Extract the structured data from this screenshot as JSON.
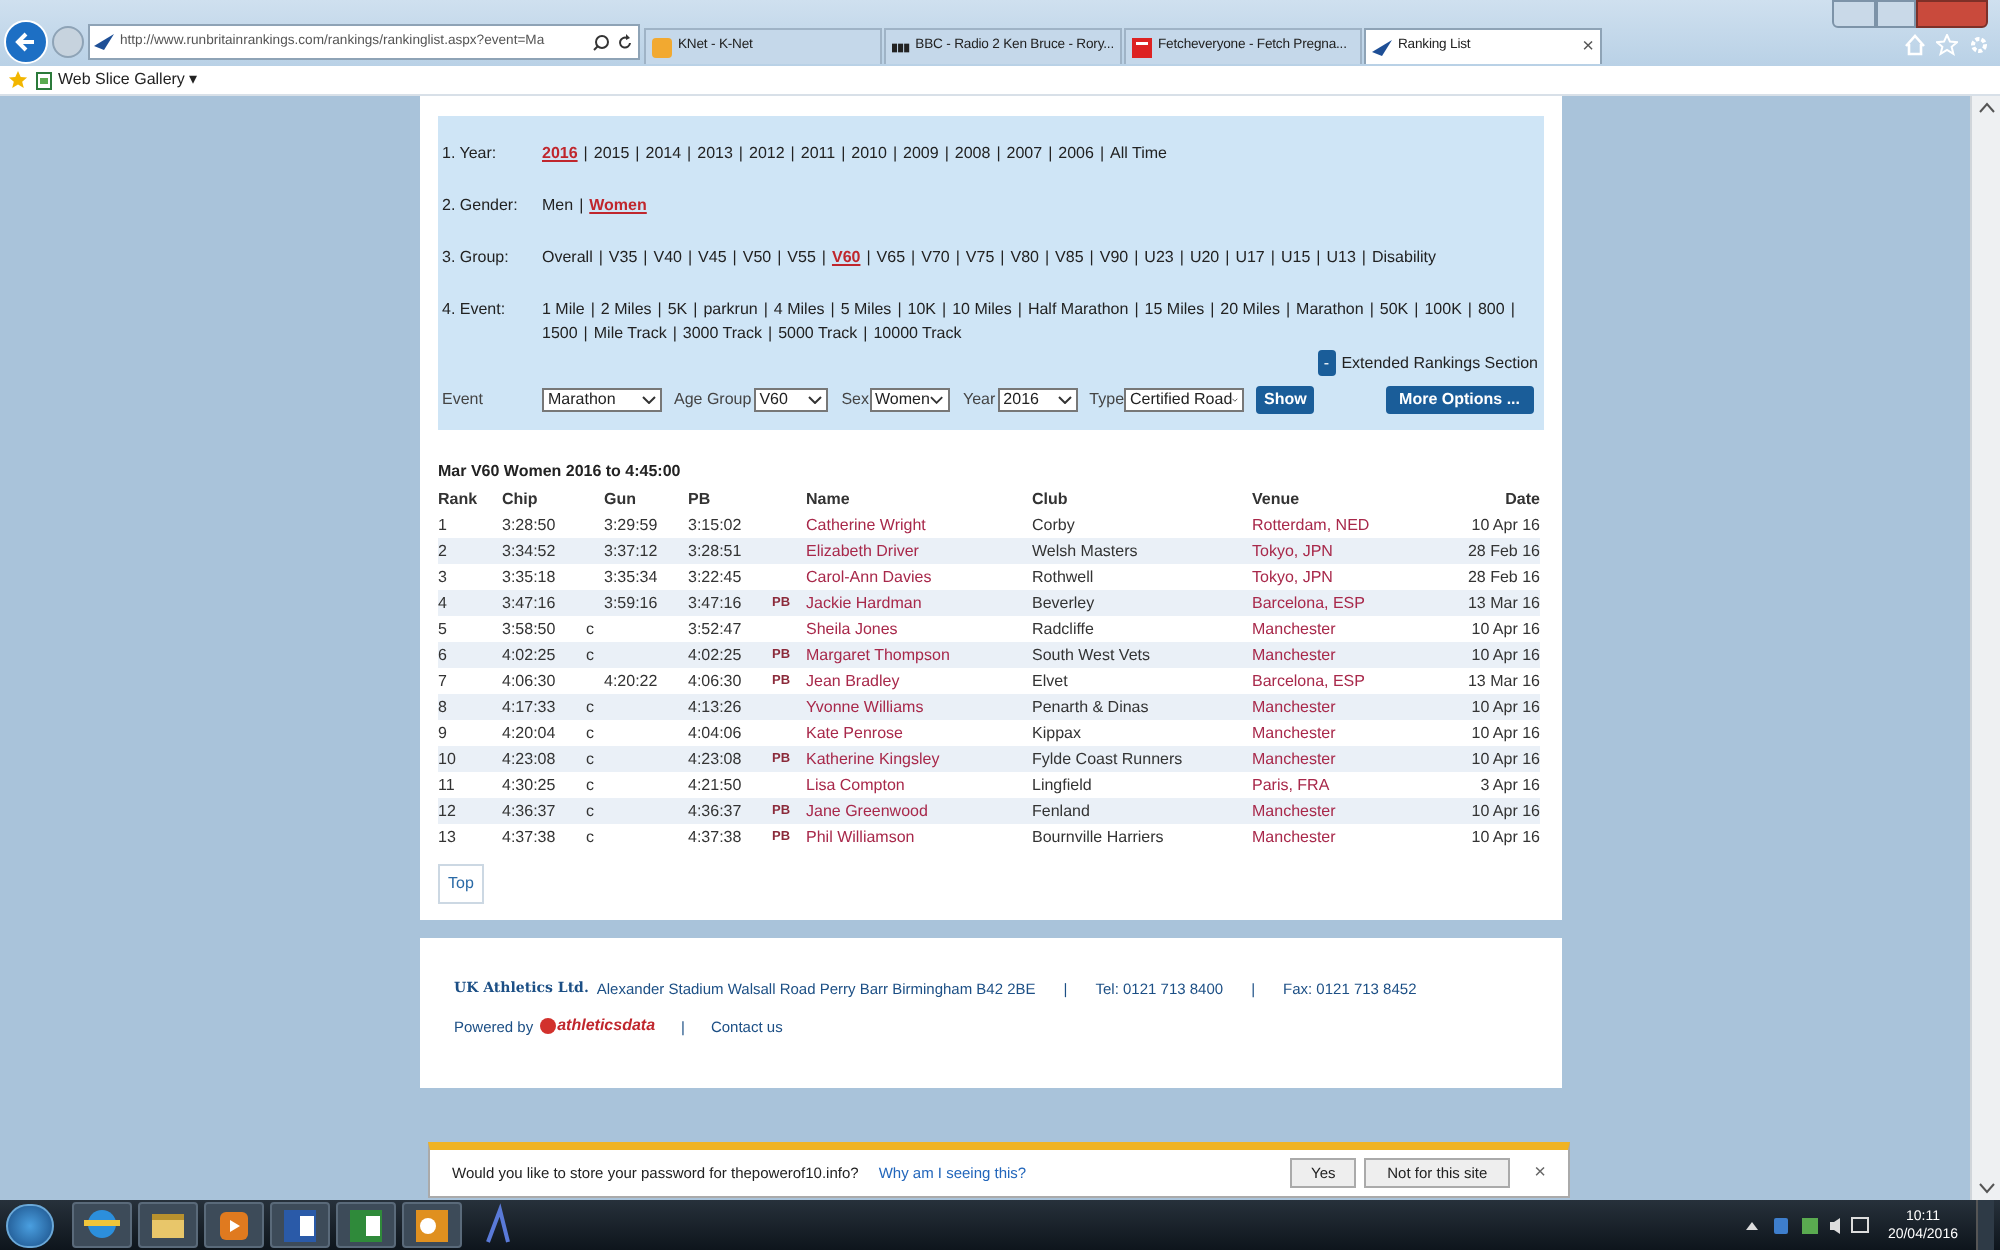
{
  "browser": {
    "address": "http://www.runbritainrankings.com/rankings/rankinglist.aspx?event=Ma",
    "tabs": [
      {
        "label": "KNet  - K-Net",
        "selected": false
      },
      {
        "label": "BBC - Radio 2 Ken Bruce - Rory...",
        "selected": false
      },
      {
        "label": "Fetcheveryone - Fetch Pregna...",
        "selected": false
      },
      {
        "label": "Ranking List",
        "selected": true,
        "close": "×"
      }
    ],
    "favorites": [
      {
        "label": "Web Slice Gallery ▾"
      }
    ]
  },
  "filters": [
    {
      "label": "1. Year:",
      "separator": "|",
      "options": [
        {
          "text": "2016",
          "selected": true
        },
        {
          "text": "2015",
          "selected": false
        },
        {
          "text": "2014",
          "selected": false
        },
        {
          "text": "2013",
          "selected": false
        },
        {
          "text": "2012",
          "selected": false
        },
        {
          "text": "2011",
          "selected": false
        },
        {
          "text": "2010",
          "selected": false
        },
        {
          "text": "2009",
          "selected": false
        },
        {
          "text": "2008",
          "selected": false
        },
        {
          "text": "2007",
          "selected": false
        },
        {
          "text": "2006",
          "selected": false
        },
        {
          "text": "All Time",
          "selected": false
        }
      ]
    },
    {
      "label": "2. Gender:",
      "separator": "|",
      "options": [
        {
          "text": "Men",
          "selected": false
        },
        {
          "text": "Women",
          "selected": true
        }
      ]
    },
    {
      "label": "3. Group:",
      "separator": "|",
      "options": [
        {
          "text": "Overall",
          "selected": false
        },
        {
          "text": "V35",
          "selected": false
        },
        {
          "text": "V40",
          "selected": false
        },
        {
          "text": "V45",
          "selected": false
        },
        {
          "text": "V50",
          "selected": false
        },
        {
          "text": "V55",
          "selected": false
        },
        {
          "text": "V60",
          "selected": true
        },
        {
          "text": "V65",
          "selected": false
        },
        {
          "text": "V70",
          "selected": false
        },
        {
          "text": "V75",
          "selected": false
        },
        {
          "text": "V80",
          "selected": false
        },
        {
          "text": "V85",
          "selected": false
        },
        {
          "text": "V90",
          "selected": false
        },
        {
          "text": "U23",
          "selected": false
        },
        {
          "text": "U20",
          "selected": false
        },
        {
          "text": "U17",
          "selected": false
        },
        {
          "text": "U15",
          "selected": false
        },
        {
          "text": "U13",
          "selected": false
        },
        {
          "text": "Disability",
          "selected": false
        }
      ]
    },
    {
      "label": "4. Event:",
      "separator": "|",
      "options": [
        {
          "text": "1 Mile",
          "selected": false
        },
        {
          "text": "2 Miles",
          "selected": false
        },
        {
          "text": "5K",
          "selected": false
        },
        {
          "text": "parkrun",
          "selected": false
        },
        {
          "text": "4 Miles",
          "selected": false
        },
        {
          "text": "5 Miles",
          "selected": false
        },
        {
          "text": "10K",
          "selected": false
        },
        {
          "text": "10 Miles",
          "selected": false
        },
        {
          "text": "Half Marathon",
          "selected": false
        },
        {
          "text": "15 Miles",
          "selected": false
        },
        {
          "text": "20 Miles",
          "selected": false
        },
        {
          "text": "Marathon",
          "selected": false
        },
        {
          "text": "50K",
          "selected": false
        },
        {
          "text": "100K",
          "selected": false
        },
        {
          "text": "800",
          "selected": false
        },
        {
          "text": "1500",
          "selected": false
        },
        {
          "text": "Mile Track",
          "selected": false
        },
        {
          "text": "3000 Track",
          "selected": false
        },
        {
          "text": "5000 Track",
          "selected": false
        },
        {
          "text": "10000 Track",
          "selected": false
        }
      ]
    }
  ],
  "extended": {
    "toggle": "-",
    "label": "Extended Rankings Section"
  },
  "controls": {
    "event_label": "Event",
    "event": "Marathon",
    "age_label": "Age Group",
    "age": "V60",
    "sex_label": "Sex",
    "sex": "Women",
    "year_label": "Year",
    "year": "2016",
    "type_label": "Type",
    "type": "Certified Road",
    "show": "Show",
    "more": "More Options ..."
  },
  "table": {
    "title": "Mar V60 Women 2016 to 4:45:00",
    "columns": [
      "Rank",
      "Chip",
      "Gun",
      "PB",
      "Name",
      "Club",
      "Venue",
      "Date"
    ],
    "rows": [
      {
        "rank": "1",
        "chip": "3:28:50",
        "gun": "3:29:59",
        "pb": "3:15:02",
        "name": "Catherine Wright",
        "club": "Corby",
        "venue": "Rotterdam, NED",
        "date": "10 Apr 16"
      },
      {
        "rank": "2",
        "chip": "3:34:52",
        "gun": "3:37:12",
        "pb": "3:28:51",
        "name": "Elizabeth Driver",
        "club": "Welsh Masters",
        "venue": "Tokyo, JPN",
        "date": "28 Feb 16"
      },
      {
        "rank": "3",
        "chip": "3:35:18",
        "gun": "3:35:34",
        "pb": "3:22:45",
        "name": "Carol-Ann Davies",
        "club": "Rothwell",
        "venue": "Tokyo, JPN",
        "date": "28 Feb 16"
      },
      {
        "rank": "4",
        "chip": "3:47:16",
        "gun": "3:59:16",
        "pb": "3:47:16",
        "pb_flag": "PB",
        "name": "Jackie Hardman",
        "club": "Beverley",
        "venue": "Barcelona, ESP",
        "date": "13 Mar 16"
      },
      {
        "rank": "5",
        "chip": "3:58:50",
        "chip_flag": "c",
        "pb": "3:52:47",
        "name": "Sheila Jones",
        "club": "Radcliffe",
        "venue": "Manchester",
        "date": "10 Apr 16"
      },
      {
        "rank": "6",
        "chip": "4:02:25",
        "chip_flag": "c",
        "pb": "4:02:25",
        "pb_flag": "PB",
        "name": "Margaret Thompson",
        "club": "South West Vets",
        "venue": "Manchester",
        "date": "10 Apr 16"
      },
      {
        "rank": "7",
        "chip": "4:06:30",
        "gun": "4:20:22",
        "pb": "4:06:30",
        "pb_flag": "PB",
        "name": "Jean Bradley",
        "club": "Elvet",
        "venue": "Barcelona, ESP",
        "date": "13 Mar 16"
      },
      {
        "rank": "8",
        "chip": "4:17:33",
        "chip_flag": "c",
        "pb": "4:13:26",
        "name": "Yvonne Williams",
        "club": "Penarth & Dinas",
        "venue": "Manchester",
        "date": "10 Apr 16"
      },
      {
        "rank": "9",
        "chip": "4:20:04",
        "chip_flag": "c",
        "pb": "4:04:06",
        "name": "Kate Penrose",
        "club": "Kippax",
        "venue": "Manchester",
        "date": "10 Apr 16"
      },
      {
        "rank": "10",
        "chip": "4:23:08",
        "chip_flag": "c",
        "pb": "4:23:08",
        "pb_flag": "PB",
        "name": "Katherine Kingsley",
        "club": "Fylde Coast Runners",
        "venue": "Manchester",
        "date": "10 Apr 16"
      },
      {
        "rank": "11",
        "chip": "4:30:25",
        "chip_flag": "c",
        "pb": "4:21:50",
        "name": "Lisa Compton",
        "club": "Lingfield",
        "venue": "Paris, FRA",
        "date": "3 Apr 16"
      },
      {
        "rank": "12",
        "chip": "4:36:37",
        "chip_flag": "c",
        "pb": "4:36:37",
        "pb_flag": "PB",
        "name": "Jane Greenwood",
        "club": "Fenland",
        "venue": "Manchester",
        "date": "10 Apr 16"
      },
      {
        "rank": "13",
        "chip": "4:37:38",
        "chip_flag": "c",
        "pb": "4:37:38",
        "pb_flag": "PB",
        "name": "Phil Williamson",
        "club": "Bournville Harriers",
        "venue": "Manchester",
        "date": "10 Apr 16"
      }
    ]
  },
  "top_button": "Top",
  "footer": {
    "company": "UK Athletics Ltd.",
    "address": "Alexander Stadium Walsall Road Perry Barr Birmingham B42 2BE",
    "sep1": "|",
    "tel": "Tel: 0121 713 8400",
    "sep2": "|",
    "fax": "Fax: 0121 713 8452",
    "powered": "Powered by",
    "brand": "athleticsdata",
    "sep3": "|",
    "contact": "Contact us"
  },
  "notification": {
    "message": "Would you like to store your password for thepowerof10.info?",
    "link": "Why am I seeing this?",
    "yes": "Yes",
    "no": "Not for this site",
    "close": "×"
  },
  "taskbar": {
    "time": "10:11",
    "date": "20/04/2016"
  }
}
